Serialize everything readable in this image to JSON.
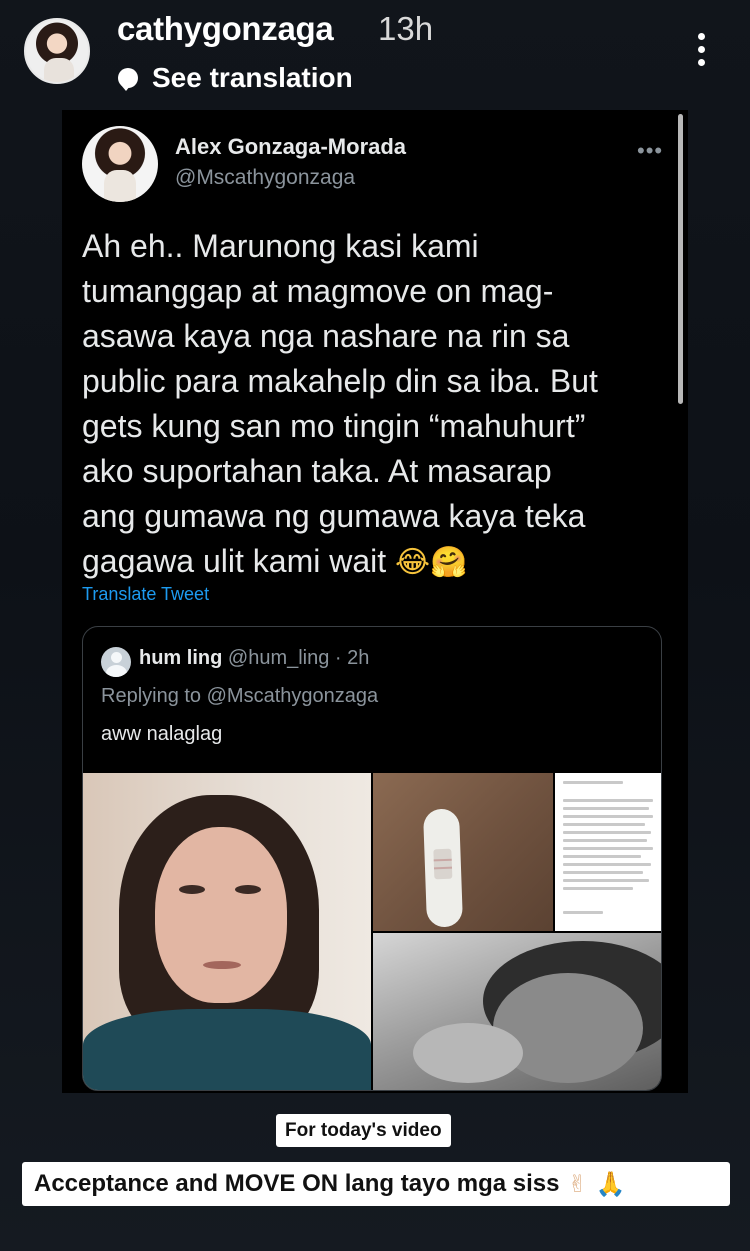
{
  "story": {
    "username": "cathygonzaga",
    "time": "13h",
    "see_translation": "See translation",
    "icons": {
      "avatar": "profile-photo",
      "translate": "speech-bubble-icon",
      "more": "vertical-ellipsis-icon"
    }
  },
  "tweet": {
    "author_name": "Alex Gonzaga-Morada",
    "handle": "@Mscathygonzaga",
    "more_label": "•••",
    "text_lines": [
      "Ah eh.. Marunong kasi kami",
      "tumanggap at magmove on mag-",
      "asawa kaya nga nashare na rin sa",
      "public para makahelp din sa iba. But",
      "gets kung san mo tingin “mahuhurt”",
      "ako suportahan taka. At masarap",
      "ang gumawa ng gumawa kaya teka",
      "gagawa ulit kami wait"
    ],
    "emojis": [
      "😂",
      "🤗"
    ],
    "translate_label": "Translate Tweet",
    "link_color": "#1d9bf0"
  },
  "quoted_tweet": {
    "name": "hum ling",
    "handle": "@hum_ling",
    "separator": "·",
    "time": "2h",
    "replying_to": "Replying to @Mscathygonzaga",
    "text": "aww nalaglag",
    "media": [
      "crying-woman-photo",
      "pregnancy-test-photo",
      "instagram-post-screenshot",
      "couple-bw-photo"
    ]
  },
  "captions": {
    "small": "For today's video",
    "large": "Acceptance and MOVE ON lang tayo mga siss",
    "large_emojis": [
      "✌",
      "🙏"
    ]
  }
}
